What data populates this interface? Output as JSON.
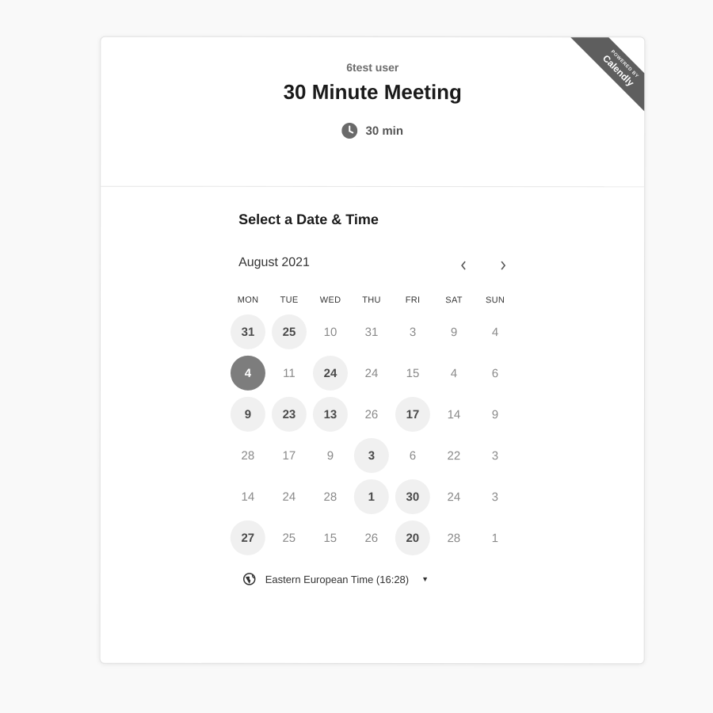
{
  "header": {
    "organizer": "6test user",
    "title": "30 Minute Meeting",
    "duration": "30 min",
    "badge_top": "POWERED BY",
    "badge_brand": "Calendly"
  },
  "calendar": {
    "section_title": "Select a Date & Time",
    "month": "August 2021",
    "weekdays": [
      "MON",
      "TUE",
      "WED",
      "THU",
      "FRI",
      "SAT",
      "SUN"
    ],
    "rows": [
      [
        {
          "d": "31",
          "s": "available"
        },
        {
          "d": "25",
          "s": "available"
        },
        {
          "d": "10",
          "s": ""
        },
        {
          "d": "31",
          "s": ""
        },
        {
          "d": "3",
          "s": ""
        },
        {
          "d": "9",
          "s": ""
        },
        {
          "d": "4",
          "s": ""
        }
      ],
      [
        {
          "d": "4",
          "s": "selected"
        },
        {
          "d": "11",
          "s": ""
        },
        {
          "d": "24",
          "s": "available"
        },
        {
          "d": "24",
          "s": ""
        },
        {
          "d": "15",
          "s": ""
        },
        {
          "d": "4",
          "s": ""
        },
        {
          "d": "6",
          "s": ""
        }
      ],
      [
        {
          "d": "9",
          "s": "available"
        },
        {
          "d": "23",
          "s": "available"
        },
        {
          "d": "13",
          "s": "available"
        },
        {
          "d": "26",
          "s": ""
        },
        {
          "d": "17",
          "s": "available"
        },
        {
          "d": "14",
          "s": ""
        },
        {
          "d": "9",
          "s": ""
        }
      ],
      [
        {
          "d": "28",
          "s": ""
        },
        {
          "d": "17",
          "s": ""
        },
        {
          "d": "9",
          "s": ""
        },
        {
          "d": "3",
          "s": "available"
        },
        {
          "d": "6",
          "s": ""
        },
        {
          "d": "22",
          "s": ""
        },
        {
          "d": "3",
          "s": ""
        }
      ],
      [
        {
          "d": "14",
          "s": ""
        },
        {
          "d": "24",
          "s": ""
        },
        {
          "d": "28",
          "s": ""
        },
        {
          "d": "1",
          "s": "available"
        },
        {
          "d": "30",
          "s": "available"
        },
        {
          "d": "24",
          "s": ""
        },
        {
          "d": "3",
          "s": ""
        }
      ],
      [
        {
          "d": "27",
          "s": "available"
        },
        {
          "d": "25",
          "s": ""
        },
        {
          "d": "15",
          "s": ""
        },
        {
          "d": "26",
          "s": ""
        },
        {
          "d": "20",
          "s": "available"
        },
        {
          "d": "28",
          "s": ""
        },
        {
          "d": "1",
          "s": ""
        }
      ]
    ]
  },
  "timezone": {
    "label": "Eastern European Time (16:28)"
  },
  "icons": {
    "duration": "clock-icon",
    "timezone": "globe-icon",
    "prev": "chevron-left-icon",
    "next": "chevron-right-icon",
    "dropdown": "caret-down-icon"
  }
}
